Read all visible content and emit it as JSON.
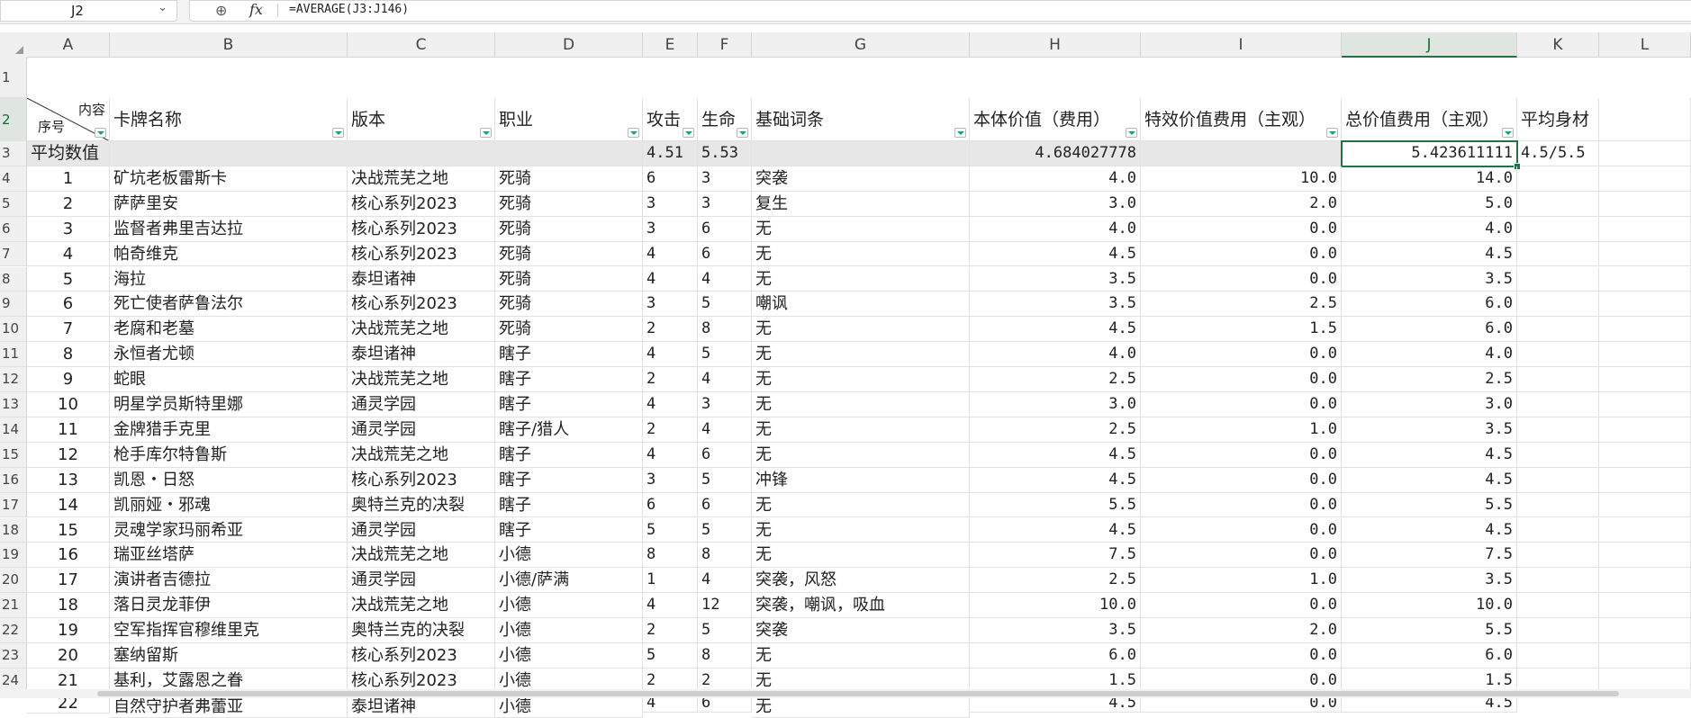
{
  "formula_bar": {
    "cell_ref": "J2",
    "formula": "=AVERAGE(J3:J146)",
    "icons": [
      "chevron-down-icon",
      "zoom-icon",
      "fx-icon"
    ]
  },
  "columns": [
    "A",
    "B",
    "C",
    "D",
    "E",
    "F",
    "G",
    "H",
    "I",
    "J",
    "K",
    "L"
  ],
  "selected_column": "J",
  "selected_row": "2",
  "header_row": {
    "a_top": "内容",
    "a_bottom": "序号",
    "cells": [
      "卡牌名称",
      "版本",
      "职业",
      "攻击",
      "生命",
      "基础词条",
      "本体价值（费用）",
      "特效价值费用（主观）",
      "总价值费用（主观）",
      "平均身材",
      ""
    ]
  },
  "average_row": {
    "label": "平均数值",
    "attack": "4.51",
    "health": "5.53",
    "base_value": "4.684027778",
    "total_value": "5.423611111",
    "avg_stats": "4.5/5.5"
  },
  "rows": [
    {
      "num": "1",
      "name": "矿坑老板雷斯卡",
      "version": "决战荒芜之地",
      "class": "死骑",
      "atk": "6",
      "hp": "3",
      "keyword": "突袭",
      "base": "4.0",
      "effect": "10.0",
      "total": "14.0"
    },
    {
      "num": "2",
      "name": "萨萨里安",
      "version": "核心系列2023",
      "class": "死骑",
      "atk": "3",
      "hp": "3",
      "keyword": "复生",
      "base": "3.0",
      "effect": "2.0",
      "total": "5.0"
    },
    {
      "num": "3",
      "name": "监督者弗里吉达拉",
      "version": "核心系列2023",
      "class": "死骑",
      "atk": "3",
      "hp": "6",
      "keyword": "无",
      "base": "4.0",
      "effect": "0.0",
      "total": "4.0"
    },
    {
      "num": "4",
      "name": "帕奇维克",
      "version": "核心系列2023",
      "class": "死骑",
      "atk": "4",
      "hp": "6",
      "keyword": "无",
      "base": "4.5",
      "effect": "0.0",
      "total": "4.5"
    },
    {
      "num": "5",
      "name": "海拉",
      "version": "泰坦诸神",
      "class": "死骑",
      "atk": "4",
      "hp": "4",
      "keyword": "无",
      "base": "3.5",
      "effect": "0.0",
      "total": "3.5"
    },
    {
      "num": "6",
      "name": "死亡使者萨鲁法尔",
      "version": "核心系列2023",
      "class": "死骑",
      "atk": "3",
      "hp": "5",
      "keyword": "嘲讽",
      "base": "3.5",
      "effect": "2.5",
      "total": "6.0"
    },
    {
      "num": "7",
      "name": "老腐和老墓",
      "version": "决战荒芜之地",
      "class": "死骑",
      "atk": "2",
      "hp": "8",
      "keyword": "无",
      "base": "4.5",
      "effect": "1.5",
      "total": "6.0"
    },
    {
      "num": "8",
      "name": "永恒者尤顿",
      "version": "泰坦诸神",
      "class": "瞎子",
      "atk": "4",
      "hp": "5",
      "keyword": "无",
      "base": "4.0",
      "effect": "0.0",
      "total": "4.0"
    },
    {
      "num": "9",
      "name": "蛇眼",
      "version": "决战荒芜之地",
      "class": "瞎子",
      "atk": "2",
      "hp": "4",
      "keyword": "无",
      "base": "2.5",
      "effect": "0.0",
      "total": "2.5"
    },
    {
      "num": "10",
      "name": "明星学员斯特里娜",
      "version": "通灵学园",
      "class": "瞎子",
      "atk": "4",
      "hp": "3",
      "keyword": "无",
      "base": "3.0",
      "effect": "0.0",
      "total": "3.0"
    },
    {
      "num": "11",
      "name": "金牌猎手克里",
      "version": "通灵学园",
      "class": "瞎子/猎人",
      "atk": "2",
      "hp": "4",
      "keyword": "无",
      "base": "2.5",
      "effect": "1.0",
      "total": "3.5"
    },
    {
      "num": "12",
      "name": "枪手库尔特鲁斯",
      "version": "决战荒芜之地",
      "class": "瞎子",
      "atk": "4",
      "hp": "6",
      "keyword": "无",
      "base": "4.5",
      "effect": "0.0",
      "total": "4.5"
    },
    {
      "num": "13",
      "name": "凯恩・日怒",
      "version": "核心系列2023",
      "class": "瞎子",
      "atk": "3",
      "hp": "5",
      "keyword": "冲锋",
      "base": "4.5",
      "effect": "0.0",
      "total": "4.5"
    },
    {
      "num": "14",
      "name": "凯丽娅・邪魂",
      "version": "奥特兰克的决裂",
      "class": "瞎子",
      "atk": "6",
      "hp": "6",
      "keyword": "无",
      "base": "5.5",
      "effect": "0.0",
      "total": "5.5"
    },
    {
      "num": "15",
      "name": "灵魂学家玛丽希亚",
      "version": "通灵学园",
      "class": "瞎子",
      "atk": "5",
      "hp": "5",
      "keyword": "无",
      "base": "4.5",
      "effect": "0.0",
      "total": "4.5"
    },
    {
      "num": "16",
      "name": "瑞亚丝塔萨",
      "version": "决战荒芜之地",
      "class": "小德",
      "atk": "8",
      "hp": "8",
      "keyword": "无",
      "base": "7.5",
      "effect": "0.0",
      "total": "7.5"
    },
    {
      "num": "17",
      "name": "演讲者吉德拉",
      "version": "通灵学园",
      "class": "小德/萨满",
      "atk": "1",
      "hp": "4",
      "keyword": "突袭，风怒",
      "base": "2.5",
      "effect": "1.0",
      "total": "3.5"
    },
    {
      "num": "18",
      "name": "落日灵龙菲伊",
      "version": "决战荒芜之地",
      "class": "小德",
      "atk": "4",
      "hp": "12",
      "keyword": "突袭，嘲讽，吸血",
      "base": "10.0",
      "effect": "0.0",
      "total": "10.0"
    },
    {
      "num": "19",
      "name": "空军指挥官穆维里克",
      "version": "奥特兰克的决裂",
      "class": "小德",
      "atk": "2",
      "hp": "5",
      "keyword": "突袭",
      "base": "3.5",
      "effect": "2.0",
      "total": "5.5"
    },
    {
      "num": "20",
      "name": "塞纳留斯",
      "version": "核心系列2023",
      "class": "小德",
      "atk": "5",
      "hp": "8",
      "keyword": "无",
      "base": "6.0",
      "effect": "0.0",
      "total": "6.0"
    },
    {
      "num": "21",
      "name": "基利，艾露恩之眷",
      "version": "核心系列2023",
      "class": "小德",
      "atk": "2",
      "hp": "2",
      "keyword": "无",
      "base": "1.5",
      "effect": "0.0",
      "total": "1.5"
    },
    {
      "num": "22",
      "name": "自然守护者弗蕾亚",
      "version": "泰坦诸神",
      "class": "小德",
      "atk": "4",
      "hp": "6",
      "keyword": "无",
      "base": "4.5",
      "effect": "0.0",
      "total": "4.5"
    }
  ]
}
